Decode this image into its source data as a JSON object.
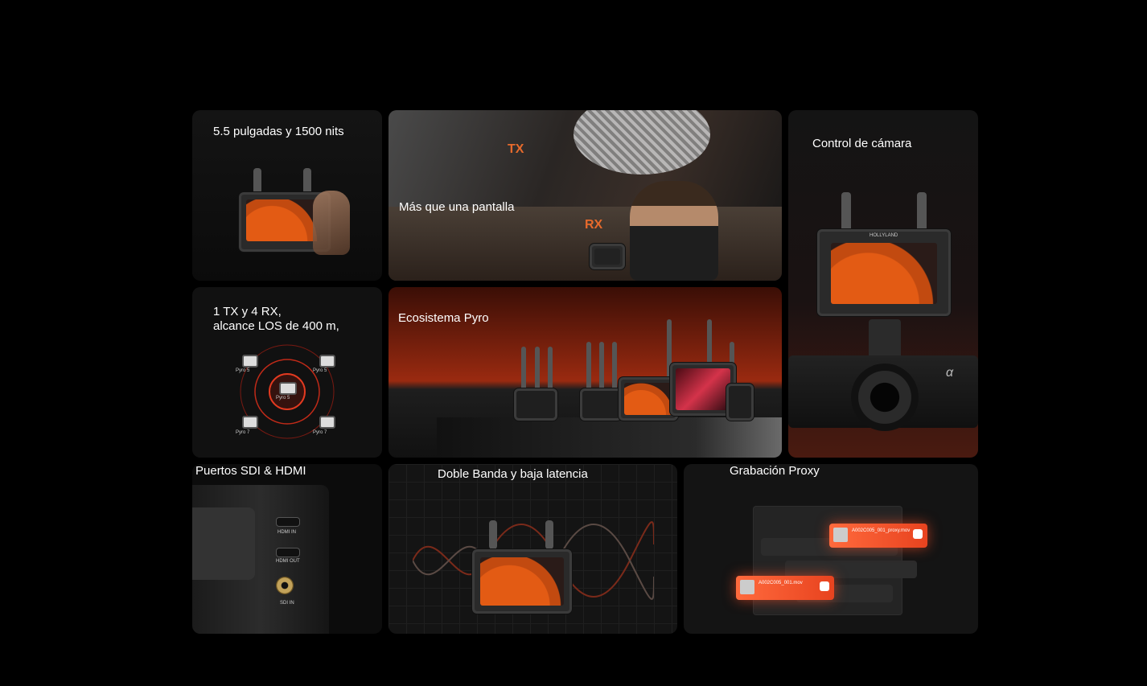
{
  "cards": {
    "display": {
      "label": "5.5 pulgadas y 1500 nits"
    },
    "screen": {
      "label": "Más que una pantalla",
      "tx": "TX",
      "rx": "RX"
    },
    "camera": {
      "label": "Control de cámara",
      "brand": "HOLLYLAND",
      "alpha": "α"
    },
    "range": {
      "label": "1 TX y 4 RX,\nalcance LOS de 400 m,",
      "center": "Pyro 5",
      "nodes": [
        "Pyro 5",
        "Pyro 5",
        "Pyro 7",
        "Pyro 7"
      ]
    },
    "ecosystem": {
      "label": "Ecosistema Pyro"
    },
    "ports": {
      "label": "Puertos SDI & HDMI",
      "hdmi_in": "HDMI IN",
      "hdmi_out": "HDMI OUT",
      "sdi_in": "SDI IN"
    },
    "dualband": {
      "label": "Doble Banda y baja latencia"
    },
    "proxy": {
      "label": "Grabación Proxy",
      "file1": "A002C005_001_proxy.mov",
      "file2": "A002C005_001.mov"
    }
  },
  "colors": {
    "accent": "#e35b14",
    "bg": "#000000",
    "card": "#121212"
  }
}
